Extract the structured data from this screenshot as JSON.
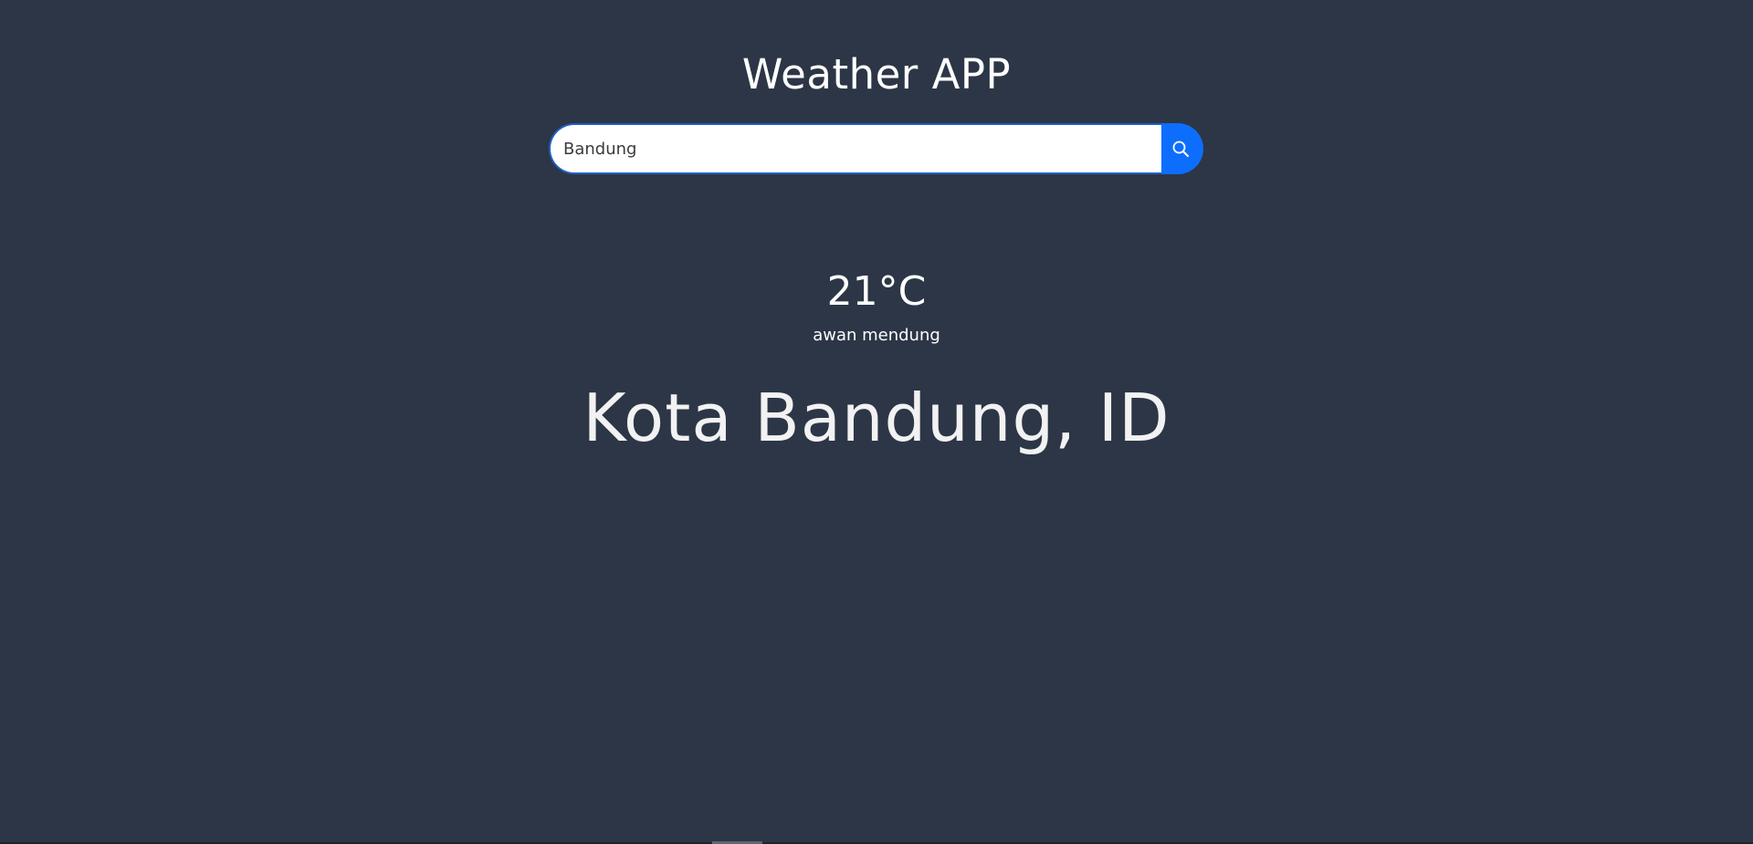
{
  "app": {
    "title": "Weather APP"
  },
  "search": {
    "value": "Bandung",
    "placeholder": "",
    "button_icon": "search-icon",
    "accent_color": "#0d6efd"
  },
  "weather": {
    "temperature": "21°C",
    "description": "awan mendung",
    "location": "Kota Bandung, ID"
  },
  "colors": {
    "background": "#2c3646",
    "text": "#ffffff"
  }
}
